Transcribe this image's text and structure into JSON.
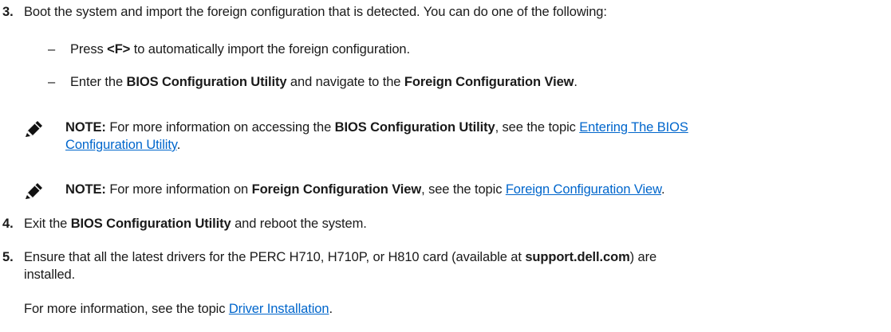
{
  "steps": [
    {
      "number": "3.",
      "text": "Boot the system and import the foreign configuration that is detected. You can do one of the following:",
      "bullets": [
        {
          "dash": "–",
          "p1": "Press ",
          "b1": "<F>",
          "p2": " to automatically import the foreign configuration."
        },
        {
          "dash": "–",
          "p1": "Enter the ",
          "b1": "BIOS Configuration Utility",
          "p2": " and navigate to the ",
          "b2": "Foreign Configuration View",
          "p3": "."
        }
      ],
      "notes": [
        {
          "label": "NOTE:",
          "p1": " For more information on accessing the ",
          "b1": "BIOS Configuration Utility",
          "p2": ", see the topic ",
          "link_line1": "Entering The BIOS",
          "link_line2": "Configuration Utility",
          "p3": "."
        },
        {
          "label": "NOTE:",
          "p1": " For more information on ",
          "b1": "Foreign Configuration View",
          "p2": ", see the topic ",
          "link": "Foreign Configuration View",
          "p3": "."
        }
      ]
    },
    {
      "number": "4.",
      "p1": "Exit the ",
      "b1": "BIOS Configuration Utility",
      "p2": " and reboot the system."
    },
    {
      "number": "5.",
      "p1": "Ensure that all the latest drivers for the PERC H710, H710P, or H810 card (available at ",
      "b1": "support.dell.com",
      "p2": ") are",
      "line2": "installed.",
      "more_p1": "For more information, see the topic ",
      "more_link": "Driver Installation",
      "more_p2": "."
    }
  ]
}
